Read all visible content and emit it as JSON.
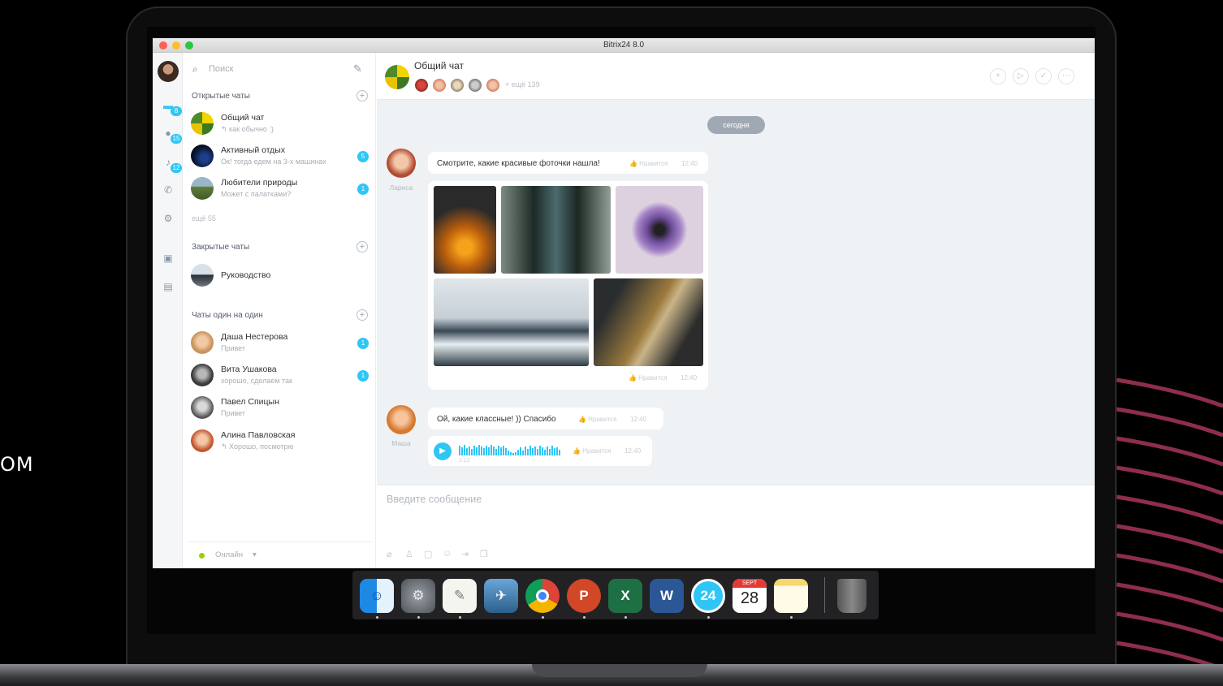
{
  "page": {
    "side_text": "ОМ"
  },
  "window": {
    "title": "Bitrix24 8.0"
  },
  "rail": {
    "badges": [
      "8",
      "15",
      "12"
    ]
  },
  "sidebar": {
    "search_placeholder": "Поиск",
    "open_chats": {
      "title": "Открытые чаты",
      "items": [
        {
          "name": "Общий чат",
          "last": "↰ как обычно :)",
          "count": ""
        },
        {
          "name": "Активный отдых",
          "last": "Ок! тогда едем на 3-х машинах",
          "count": "5"
        },
        {
          "name": "Любители природы",
          "last": "Может с палатками?",
          "count": "1"
        }
      ],
      "more": "ещё 55"
    },
    "closed_chats": {
      "title": "Закрытые чаты",
      "items": [
        {
          "name": "Руководство",
          "last": ""
        }
      ]
    },
    "direct_chats": {
      "title": "Чаты один на один",
      "items": [
        {
          "name": "Даша Нестерова",
          "last": "Привет",
          "count": "1"
        },
        {
          "name": "Вита Ушакова",
          "last": "хорошо, сделаем так",
          "count": "1"
        },
        {
          "name": "Павел Спицын",
          "last": "Привет",
          "count": ""
        },
        {
          "name": "Алина Павловская",
          "last": "↰ Хорошо, посмотрю",
          "count": ""
        }
      ]
    },
    "status": "Онлайн"
  },
  "chat": {
    "title": "Общий чат",
    "members_more": "+ ещё 139",
    "date_divider": "сегодня",
    "messages": [
      {
        "author": "Лариса",
        "text": "Смотрите, какие красивые фоточки нашла!",
        "like": "👍 Нравится",
        "time": "12:40"
      },
      {
        "author": "Лариса",
        "like": "👍 Нравится",
        "time": "12:40"
      },
      {
        "author": "Маша",
        "text": "Ой, какие классные! )) Спасибо",
        "like": "👍 Нравится",
        "time": "12:40"
      },
      {
        "author": "Маша",
        "duration": "1:12",
        "like": "👍 Нравится",
        "time": "12:40"
      }
    ],
    "composer_placeholder": "Введите сообщение"
  },
  "dock": {
    "apps": [
      {
        "name": "Finder",
        "glyph": "☺"
      },
      {
        "name": "System Preferences",
        "glyph": "⚙"
      },
      {
        "name": "TextEdit",
        "glyph": "✎"
      },
      {
        "name": "Preview",
        "glyph": "✈"
      },
      {
        "name": "Chrome",
        "glyph": ""
      },
      {
        "name": "PowerPoint",
        "glyph": "P"
      },
      {
        "name": "Excel",
        "glyph": "X"
      },
      {
        "name": "Word",
        "glyph": "W"
      },
      {
        "name": "Bitrix24",
        "glyph": "24"
      },
      {
        "name": "Calendar",
        "glyph": "28"
      },
      {
        "name": "Notes",
        "glyph": ""
      }
    ],
    "calendar_month": "SEPT"
  }
}
